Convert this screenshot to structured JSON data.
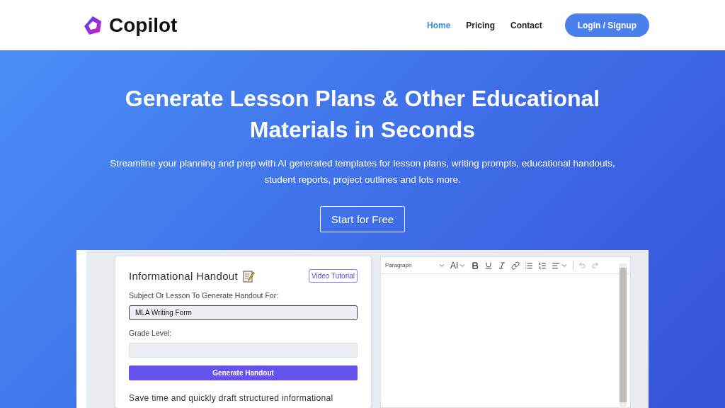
{
  "header": {
    "logo": "Copilot",
    "nav": [
      {
        "label": "Home",
        "selected": true
      },
      {
        "label": "Pricing",
        "selected": false
      },
      {
        "label": "Contact",
        "selected": false
      }
    ],
    "login_button": "Login / Signup"
  },
  "hero": {
    "title": "Generate Lesson Plans & Other Educational Materials in Seconds",
    "subtitle": "Streamline your planning and prep with AI generated templates for lesson plans, writing prompts, educational handouts, student reports, project outlines and lots more.",
    "cta": "Start for Free"
  },
  "preview": {
    "form": {
      "title": "Informational Handout",
      "video_button": "Video Tutorial",
      "subject_label": "Subject Or Lesson To Generate Handout For:",
      "subject_value": "MLA Writing Form",
      "grade_label": "Grade Level:",
      "generate_button": "Generate Handout",
      "description": "Save time and quickly draft structured informational"
    },
    "editor": {
      "block_style": "Paragraph",
      "ai_label": "AI"
    }
  }
}
